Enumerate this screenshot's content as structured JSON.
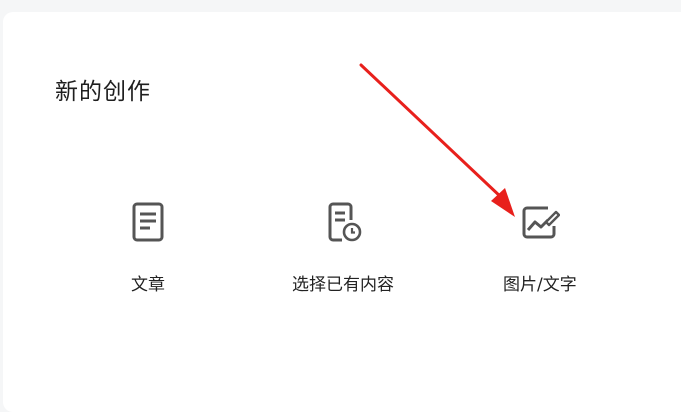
{
  "panel": {
    "title": "新的创作"
  },
  "options": [
    {
      "label": "文章",
      "icon": "document-icon"
    },
    {
      "label": "选择已有内容",
      "icon": "document-clock-icon"
    },
    {
      "label": "图片/文字",
      "icon": "image-edit-icon"
    }
  ],
  "annotation": {
    "arrow_color": "#e8201c",
    "icon_color": "#555555"
  }
}
